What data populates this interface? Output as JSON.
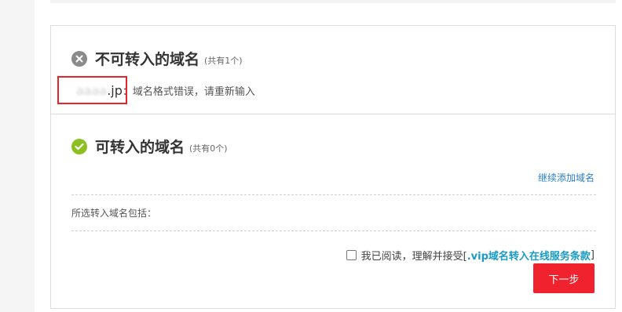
{
  "invalid_section": {
    "title": "不可转入的域名",
    "count": "(共有1个)",
    "domain": "aaaa.jp",
    "domain_blurred": "aaaa",
    "domain_suffix": ".jp",
    "separator": "：",
    "error_message": "域名格式错误，请重新输入"
  },
  "valid_section": {
    "title": "可转入的域名",
    "count": "(共有0个)",
    "add_link": "继续添加域名",
    "included_label": "所选转入域名包括："
  },
  "agreement": {
    "prefix": "我已阅读，理解并接受[",
    "terms_link": ".vip域名转入在线服务条款",
    "suffix": "]"
  },
  "next_button": "下一步",
  "colors": {
    "error_icon": "#8a8a8a",
    "success_icon": "#8cc020",
    "link": "#2a7fc8",
    "terms_link": "#1a9ac4",
    "primary_button": "#f0222e",
    "highlight_box": "#e8232a"
  }
}
